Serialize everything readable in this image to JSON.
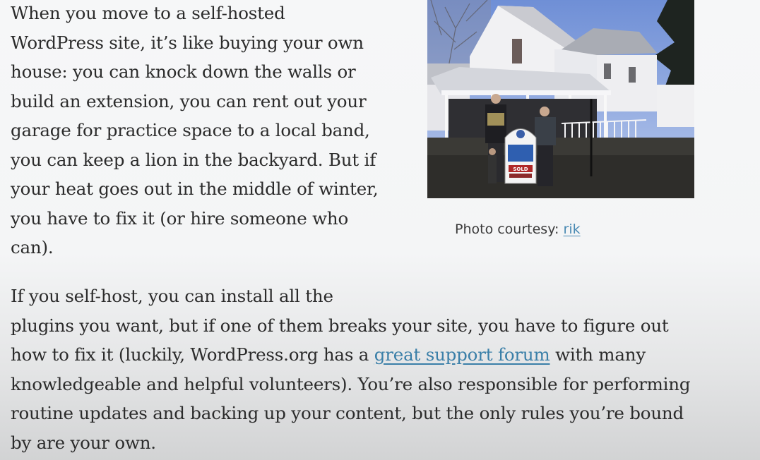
{
  "article": {
    "paragraph1": {
      "lines": [
        "When you move to a self-hosted",
        "WordPress site, it’s like buying your own",
        "house: you can knock down the walls or",
        "build an extension, you can rent out your",
        "garage for practice space to a local band,",
        "you can keep a lion in the backyard. But if",
        "your heat goes out in the middle of winter,",
        "you have to fix it (or hire someone who",
        "can)."
      ]
    },
    "paragraph2": {
      "line1": "If you self-host, you can install all the",
      "line2": "plugins you want, but if one of them breaks your site, you have to figure out",
      "line3_before": "how to fix it (luckily, WordPress.org has a ",
      "line3_link": "great support forum",
      "line3_after": " with many",
      "line4": "knowledgeable and helpful volunteers). You’re also responsible for performing",
      "line5": "routine updates and backing up your content, but the only rules you’re bound",
      "line6": "by are your own."
    }
  },
  "figure": {
    "caption_prefix": "Photo courtesy: ",
    "caption_link": "rik",
    "sign_text": "SOLD"
  },
  "colors": {
    "link": "#3a7fa8",
    "text": "#2b2b2b"
  }
}
